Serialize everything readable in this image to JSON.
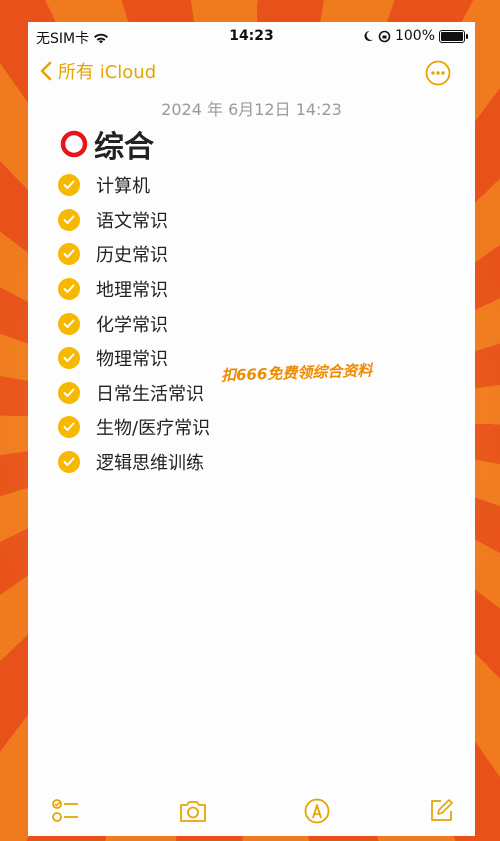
{
  "status_bar": {
    "carrier": "无SIM卡",
    "time": "14:23",
    "battery_percent": "100%",
    "battery_level": 1.0
  },
  "nav": {
    "back_label": "所有 iCloud",
    "back_icon": "chevron-left-icon",
    "more_icon": "ellipsis-circle-icon"
  },
  "note": {
    "date": "2024 年 6月12日 14:23",
    "title": "综合",
    "items": [
      {
        "label": "计算机",
        "checked": true
      },
      {
        "label": "语文常识",
        "checked": true
      },
      {
        "label": "历史常识",
        "checked": true
      },
      {
        "label": "地理常识",
        "checked": true
      },
      {
        "label": "化学常识",
        "checked": true
      },
      {
        "label": "物理常识",
        "checked": true
      },
      {
        "label": "日常生活常识",
        "checked": true
      },
      {
        "label": "生物/医疗常识",
        "checked": true
      },
      {
        "label": "逻辑思维训练",
        "checked": true
      }
    ]
  },
  "watermark": "扣666免费领综合资料",
  "toolbar": {
    "icons": [
      "checklist-icon",
      "camera-icon",
      "markup-pen-icon",
      "compose-icon"
    ]
  },
  "colors": {
    "accent": "#e5a500",
    "check": "#f7b800",
    "ring": "#e8141a",
    "watermark": "#f08a00"
  }
}
